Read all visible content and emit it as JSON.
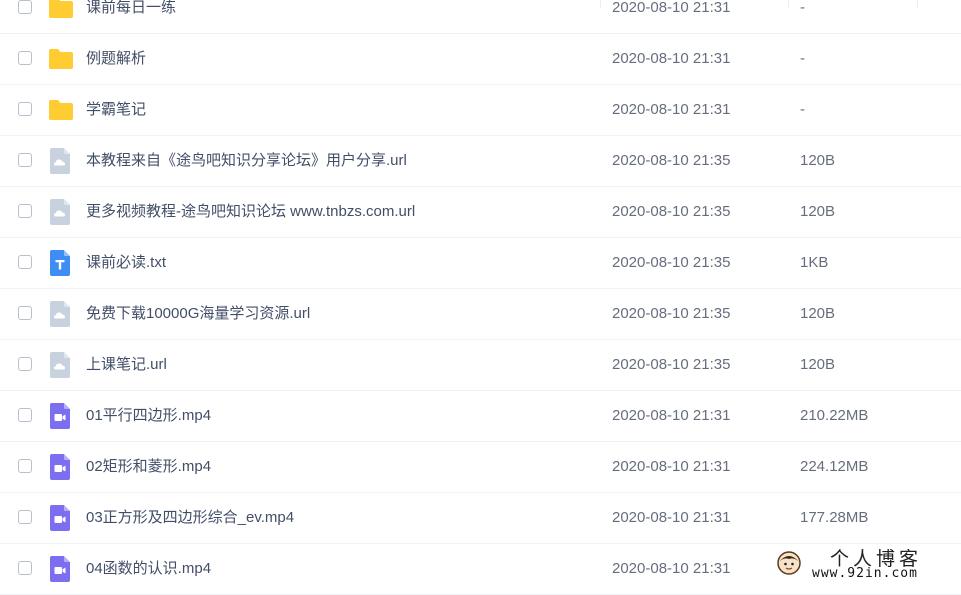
{
  "files": [
    {
      "name": "课前每日一练",
      "date": "2020-08-10 21:31",
      "size": "-",
      "type": "folder"
    },
    {
      "name": "例题解析",
      "date": "2020-08-10 21:31",
      "size": "-",
      "type": "folder"
    },
    {
      "name": "学霸笔记",
      "date": "2020-08-10 21:31",
      "size": "-",
      "type": "folder"
    },
    {
      "name": "本教程来自《途鸟吧知识分享论坛》用户分享.url",
      "date": "2020-08-10 21:35",
      "size": "120B",
      "type": "url"
    },
    {
      "name": "更多视频教程-途鸟吧知识论坛 www.tnbzs.com.url",
      "date": "2020-08-10 21:35",
      "size": "120B",
      "type": "url"
    },
    {
      "name": "课前必读.txt",
      "date": "2020-08-10 21:35",
      "size": "1KB",
      "type": "txt"
    },
    {
      "name": "免费下载10000G海量学习资源.url",
      "date": "2020-08-10 21:35",
      "size": "120B",
      "type": "url"
    },
    {
      "name": "上课笔记.url",
      "date": "2020-08-10 21:35",
      "size": "120B",
      "type": "url"
    },
    {
      "name": "01平行四边形.mp4",
      "date": "2020-08-10 21:31",
      "size": "210.22MB",
      "type": "video"
    },
    {
      "name": "02矩形和菱形.mp4",
      "date": "2020-08-10 21:31",
      "size": "224.12MB",
      "type": "video"
    },
    {
      "name": "03正方形及四边形综合_ev.mp4",
      "date": "2020-08-10 21:31",
      "size": "177.28MB",
      "type": "video"
    },
    {
      "name": "04函数的认识.mp4",
      "date": "2020-08-10 21:31",
      "size": "",
      "type": "video"
    }
  ],
  "icons": {
    "folder": "folder-icon",
    "url": "link-file-icon",
    "txt": "text-file-icon",
    "video": "video-file-icon"
  },
  "colors": {
    "folder": "#ffcc33",
    "url": "#c7d2de",
    "txt": "#3f8cf5",
    "video": "#7b6ef0"
  },
  "watermark": {
    "title": "个人博客",
    "url": "www.92in.com"
  }
}
